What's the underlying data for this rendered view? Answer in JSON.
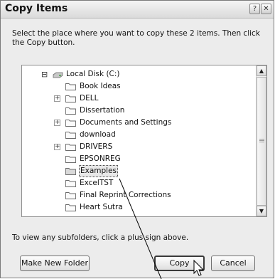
{
  "dialog": {
    "title": "Copy Items",
    "help_glyph": "?",
    "close_glyph": "✕",
    "instructions": "Select the place where you want to copy these 2 items. Then click the Copy button."
  },
  "tree": {
    "root": {
      "label": "Local Disk (C:)",
      "expander": "⊟",
      "icon": "drive-icon"
    },
    "folders": [
      {
        "label": "Book Ideas",
        "expander": ""
      },
      {
        "label": "DELL",
        "expander": "+"
      },
      {
        "label": "Dissertation",
        "expander": ""
      },
      {
        "label": "Documents and Settings",
        "expander": "+"
      },
      {
        "label": "download",
        "expander": ""
      },
      {
        "label": "DRIVERS",
        "expander": "+"
      },
      {
        "label": "EPSONREG",
        "expander": ""
      },
      {
        "label": "Examples",
        "expander": "",
        "selected": true
      },
      {
        "label": "ExcelTST",
        "expander": ""
      },
      {
        "label": "Final Reprint Corrections",
        "expander": ""
      },
      {
        "label": "Heart Sutra",
        "expander": ""
      }
    ],
    "scroll_up_glyph": "▲",
    "scroll_down_glyph": "▼"
  },
  "hint": "To view any subfolders, click a plus sign above.",
  "buttons": {
    "make_new_folder": "Make New Folder",
    "copy": "Copy",
    "cancel": "Cancel"
  },
  "colors": {
    "dialog_bg": "#ececec",
    "folder": "#f3d37a",
    "selection": "#e8e8e8"
  }
}
